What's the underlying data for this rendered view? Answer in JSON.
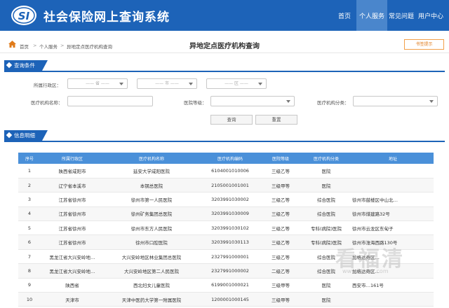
{
  "app": {
    "title": "社会保险网上查询系统"
  },
  "nav": {
    "items": [
      "首页",
      "个人服务",
      "常见问题",
      "用户中心"
    ],
    "active": "个人服务"
  },
  "breadcrumb": [
    "首页",
    "个人服务",
    "异地定点医疗机构查询"
  ],
  "page_title": "异地定点医疗机构查询",
  "top_button": "书签提示",
  "query": {
    "section_title": "查询条件",
    "region_label": "所属行政区：",
    "province": "—— 省 ——",
    "city": "—— 市 ——",
    "district": "—— 区 ——",
    "name_label": "医疗机构名称：",
    "level_label": "医院等级：",
    "category_label": "医疗机构分类：",
    "search_button": "查询",
    "reset_button": "重置"
  },
  "results": {
    "section_title": "信息明细",
    "columns": [
      "序号",
      "所属行政区",
      "医疗机构名称",
      "医疗机构编码",
      "医院等级",
      "医疗机构分类",
      "地址"
    ],
    "rows": [
      [
        "1",
        "陕西省咸阳市",
        "延安大学咸阳医院",
        "6104001010006",
        "三级乙等",
        "医院",
        ""
      ],
      [
        "2",
        "辽宁省本溪市",
        "本钢总医院",
        "2105001001001",
        "三级甲等",
        "医院",
        ""
      ],
      [
        "3",
        "江苏省徐州市",
        "徐州市第一人民医院",
        "3203991030002",
        "三级乙等",
        "综合医院",
        "徐州市鼓楼区中山北…"
      ],
      [
        "4",
        "江苏省徐州市",
        "徐州矿务集团总医院",
        "3203991030009",
        "三级乙等",
        "综合医院",
        "徐州市煤建路32号"
      ],
      [
        "5",
        "江苏省徐州市",
        "徐州市东方人民医院",
        "3203991030102",
        "三级乙等",
        "专科(病院)医院",
        "徐州市云龙区东甸子"
      ],
      [
        "6",
        "江苏省徐州市",
        "徐州市口腔医院",
        "3203991030113",
        "三级乙等",
        "专科(病院)医院",
        "徐州市淮海西路130号"
      ],
      [
        "7",
        "黑龙江省大兴安岭地…",
        "大兴安岭地区林业集团总医院",
        "2327991000001",
        "三级乙等",
        "综合医院",
        "加格达奇区…"
      ],
      [
        "8",
        "黑龙江省大兴安岭地…",
        "大兴安岭地区第二人民医院",
        "2327991000002",
        "二级乙等",
        "综合医院",
        "加格达奇区…"
      ],
      [
        "9",
        "陕西省",
        "西北妇女儿童医院",
        "6199001000021",
        "三级甲等",
        "医院",
        "西安市…161号"
      ],
      [
        "10",
        "天津市",
        "天津中医药大学第一附属医院",
        "1200001000145",
        "三级甲等",
        "医院",
        ""
      ]
    ]
  },
  "watermark": {
    "text": "看福清",
    "url": "www.fqlook.com"
  },
  "colors": {
    "header": "#1d63b8",
    "nav_active": "#4a86cc",
    "table_header": "#4a90d9",
    "accent_orange": "#e07b1a"
  }
}
